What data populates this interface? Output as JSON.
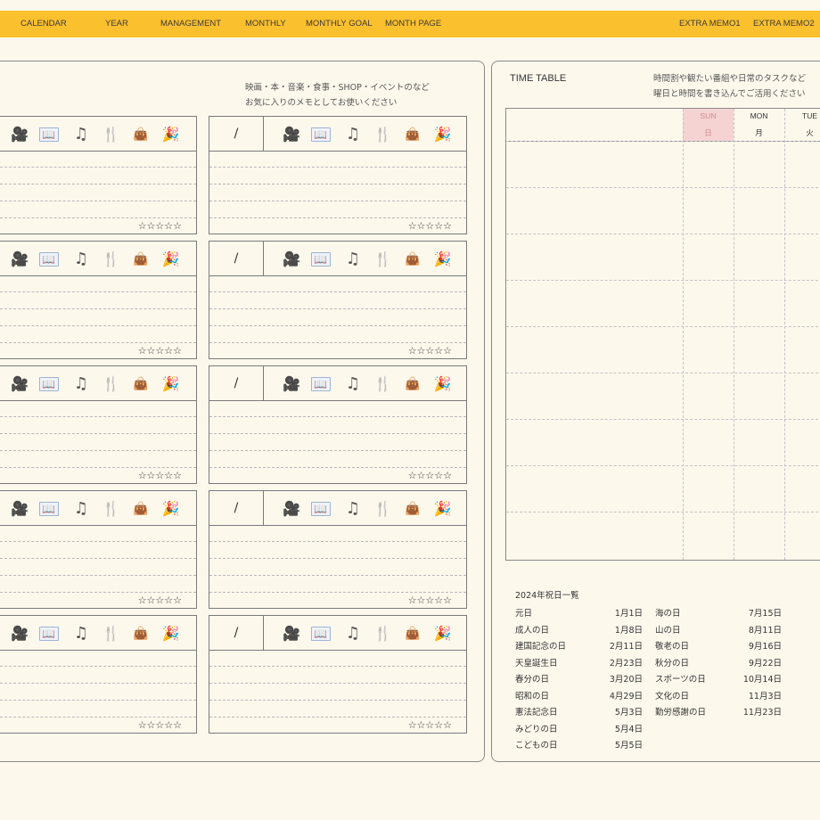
{
  "nav": {
    "items": [
      "CALENDAR",
      "YEAR",
      "MANAGEMENT",
      "MONTHLY",
      "MONTHLY GOAL",
      "MONTH PAGE",
      "EXTRA MEMO1",
      "EXTRA MEMO2"
    ]
  },
  "memo": {
    "note_line1": "映画・本・音楽・食事・SHOP・イベントのなど",
    "note_line2": "お気に入りのメモとしてお使いください",
    "date_slash": "/",
    "rating": "☆☆☆☆☆",
    "icons": [
      "film-camera-icon",
      "book-icon",
      "music-notes-icon",
      "fork-knife-icon",
      "handbag-icon",
      "party-popper-icon"
    ]
  },
  "timetable": {
    "title": "TIME TABLE",
    "note_line1": "時間割や観たい番組や日常のタスクなど",
    "note_line2": "曜日と時間を書き込んでご活用ください",
    "days": [
      {
        "en": "SUN",
        "jp": "日"
      },
      {
        "en": "MON",
        "jp": "月"
      },
      {
        "en": "TUE",
        "jp": "火"
      }
    ],
    "sun_color": "#f6d3d3"
  },
  "holidays": {
    "title": "2024年祝日一覧",
    "left": [
      {
        "name": "元日",
        "date": "1月1日"
      },
      {
        "name": "成人の日",
        "date": "1月8日"
      },
      {
        "name": "建国記念の日",
        "date": "2月11日"
      },
      {
        "name": "天皇誕生日",
        "date": "2月23日"
      },
      {
        "name": "春分の日",
        "date": "3月20日"
      },
      {
        "name": "昭和の日",
        "date": "4月29日"
      },
      {
        "name": "憲法記念日",
        "date": "5月3日"
      },
      {
        "name": "みどりの日",
        "date": "5月4日"
      },
      {
        "name": "こどもの日",
        "date": "5月5日"
      }
    ],
    "right": [
      {
        "name": "海の日",
        "date": "7月15日"
      },
      {
        "name": "山の日",
        "date": "8月11日"
      },
      {
        "name": "敬老の日",
        "date": "9月16日"
      },
      {
        "name": "秋分の日",
        "date": "9月22日"
      },
      {
        "name": "スポーツの日",
        "date": "10月14日"
      },
      {
        "name": "文化の日",
        "date": "11月3日"
      },
      {
        "name": "勤労感謝の日",
        "date": "11月23日"
      }
    ]
  },
  "colors": {
    "topbar": "#fbc02d",
    "background": "#fdf8ec"
  }
}
